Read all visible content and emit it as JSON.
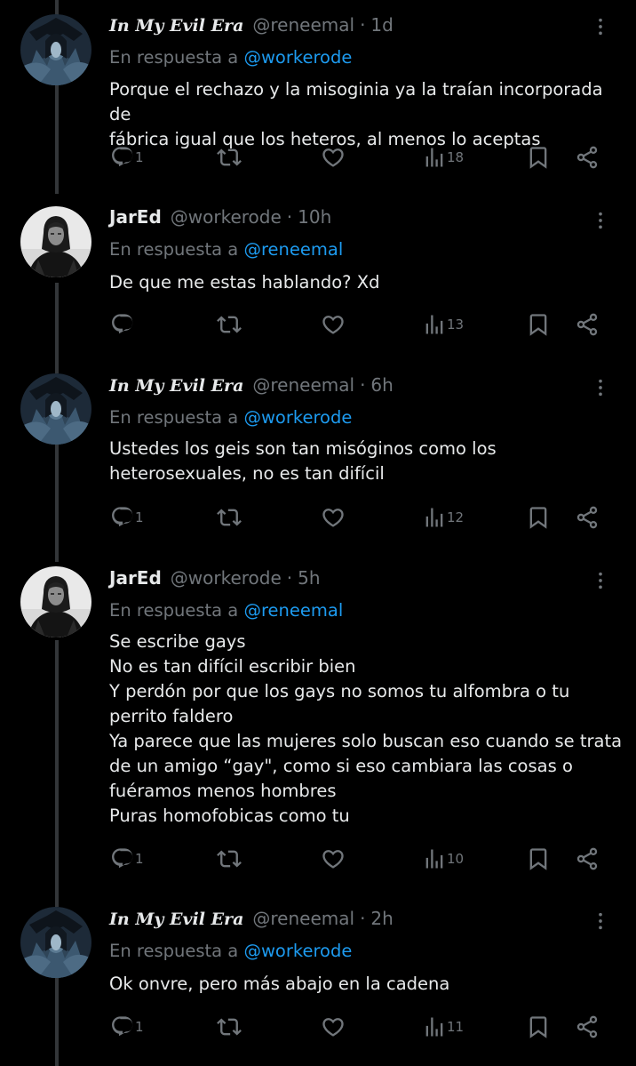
{
  "tweets": [
    {
      "name": "In My Evil Era",
      "handle": "@reneemal",
      "time": "1d",
      "reply_prefix": "En respuesta a",
      "reply_to": "@workerode",
      "text": "Porque el rechazo y la misoginia ya la traían incorporada de\nfábrica igual que los heteros, al menos lo aceptas",
      "replies": "1",
      "views": "18"
    },
    {
      "name": "JarEd",
      "handle": "@workerode",
      "time": "10h",
      "reply_prefix": "En respuesta a",
      "reply_to": "@reneemal",
      "text": "De que me estas hablando? Xd",
      "replies": "",
      "views": "13"
    },
    {
      "name": "In My Evil Era",
      "handle": "@reneemal",
      "time": "6h",
      "reply_prefix": "En respuesta a",
      "reply_to": "@workerode",
      "text": "Ustedes los geis son tan misóginos como los\nheterosexuales, no es tan difícil",
      "replies": "1",
      "views": "12"
    },
    {
      "name": "JarEd",
      "handle": "@workerode",
      "time": "5h",
      "reply_prefix": "En respuesta a",
      "reply_to": "@reneemal",
      "text": "Se escribe gays\nNo es tan difícil escribir bien\nY perdón por que los gays no somos tu alfombra o tu\nperrito faldero\nYa parece que las mujeres solo buscan eso cuando se trata\nde un amigo “gay\", como si eso cambiara las cosas o\nfuéramos menos hombres\nPuras homofobicas como tu",
      "replies": "1",
      "views": "10"
    },
    {
      "name": "In My Evil Era",
      "handle": "@reneemal",
      "time": "2h",
      "reply_prefix": "En respuesta a",
      "reply_to": "@workerode",
      "text": "Ok onvre, pero más abajo en la cadena",
      "replies": "1",
      "views": "11"
    }
  ],
  "icons": {
    "reply": "reply-icon",
    "retweet": "retweet-icon",
    "like": "like-icon",
    "views": "views-icon",
    "bookmark": "bookmark-icon",
    "share": "share-icon",
    "more": "more-icon"
  },
  "colors": {
    "background": "#000000",
    "text": "#e7e9ea",
    "muted": "#71767b",
    "mention": "#1d9bf0",
    "thread_line": "#333639"
  }
}
